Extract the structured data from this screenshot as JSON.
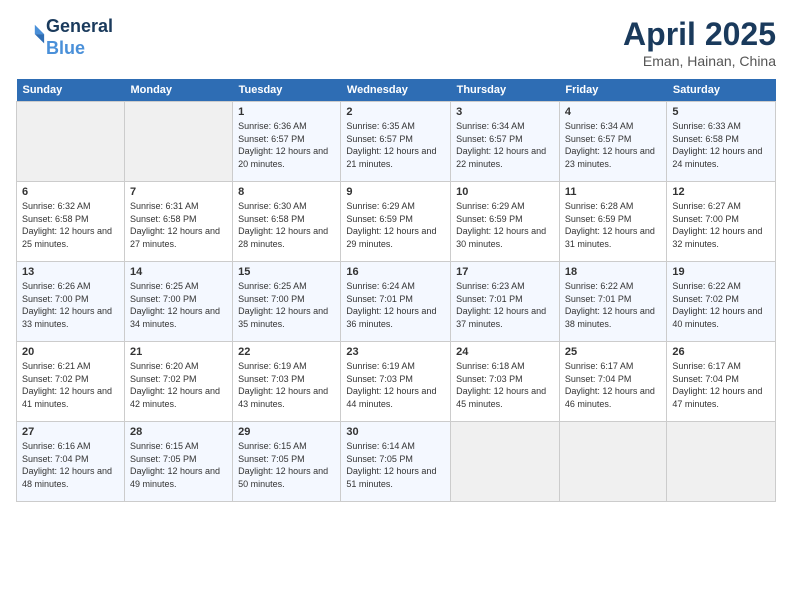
{
  "header": {
    "logo_line1": "General",
    "logo_line2": "Blue",
    "month_year": "April 2025",
    "location": "Eman, Hainan, China"
  },
  "weekdays": [
    "Sunday",
    "Monday",
    "Tuesday",
    "Wednesday",
    "Thursday",
    "Friday",
    "Saturday"
  ],
  "weeks": [
    [
      {
        "day": "",
        "info": ""
      },
      {
        "day": "",
        "info": ""
      },
      {
        "day": "1",
        "info": "Sunrise: 6:36 AM\nSunset: 6:57 PM\nDaylight: 12 hours and 20 minutes."
      },
      {
        "day": "2",
        "info": "Sunrise: 6:35 AM\nSunset: 6:57 PM\nDaylight: 12 hours and 21 minutes."
      },
      {
        "day": "3",
        "info": "Sunrise: 6:34 AM\nSunset: 6:57 PM\nDaylight: 12 hours and 22 minutes."
      },
      {
        "day": "4",
        "info": "Sunrise: 6:34 AM\nSunset: 6:57 PM\nDaylight: 12 hours and 23 minutes."
      },
      {
        "day": "5",
        "info": "Sunrise: 6:33 AM\nSunset: 6:58 PM\nDaylight: 12 hours and 24 minutes."
      }
    ],
    [
      {
        "day": "6",
        "info": "Sunrise: 6:32 AM\nSunset: 6:58 PM\nDaylight: 12 hours and 25 minutes."
      },
      {
        "day": "7",
        "info": "Sunrise: 6:31 AM\nSunset: 6:58 PM\nDaylight: 12 hours and 27 minutes."
      },
      {
        "day": "8",
        "info": "Sunrise: 6:30 AM\nSunset: 6:58 PM\nDaylight: 12 hours and 28 minutes."
      },
      {
        "day": "9",
        "info": "Sunrise: 6:29 AM\nSunset: 6:59 PM\nDaylight: 12 hours and 29 minutes."
      },
      {
        "day": "10",
        "info": "Sunrise: 6:29 AM\nSunset: 6:59 PM\nDaylight: 12 hours and 30 minutes."
      },
      {
        "day": "11",
        "info": "Sunrise: 6:28 AM\nSunset: 6:59 PM\nDaylight: 12 hours and 31 minutes."
      },
      {
        "day": "12",
        "info": "Sunrise: 6:27 AM\nSunset: 7:00 PM\nDaylight: 12 hours and 32 minutes."
      }
    ],
    [
      {
        "day": "13",
        "info": "Sunrise: 6:26 AM\nSunset: 7:00 PM\nDaylight: 12 hours and 33 minutes."
      },
      {
        "day": "14",
        "info": "Sunrise: 6:25 AM\nSunset: 7:00 PM\nDaylight: 12 hours and 34 minutes."
      },
      {
        "day": "15",
        "info": "Sunrise: 6:25 AM\nSunset: 7:00 PM\nDaylight: 12 hours and 35 minutes."
      },
      {
        "day": "16",
        "info": "Sunrise: 6:24 AM\nSunset: 7:01 PM\nDaylight: 12 hours and 36 minutes."
      },
      {
        "day": "17",
        "info": "Sunrise: 6:23 AM\nSunset: 7:01 PM\nDaylight: 12 hours and 37 minutes."
      },
      {
        "day": "18",
        "info": "Sunrise: 6:22 AM\nSunset: 7:01 PM\nDaylight: 12 hours and 38 minutes."
      },
      {
        "day": "19",
        "info": "Sunrise: 6:22 AM\nSunset: 7:02 PM\nDaylight: 12 hours and 40 minutes."
      }
    ],
    [
      {
        "day": "20",
        "info": "Sunrise: 6:21 AM\nSunset: 7:02 PM\nDaylight: 12 hours and 41 minutes."
      },
      {
        "day": "21",
        "info": "Sunrise: 6:20 AM\nSunset: 7:02 PM\nDaylight: 12 hours and 42 minutes."
      },
      {
        "day": "22",
        "info": "Sunrise: 6:19 AM\nSunset: 7:03 PM\nDaylight: 12 hours and 43 minutes."
      },
      {
        "day": "23",
        "info": "Sunrise: 6:19 AM\nSunset: 7:03 PM\nDaylight: 12 hours and 44 minutes."
      },
      {
        "day": "24",
        "info": "Sunrise: 6:18 AM\nSunset: 7:03 PM\nDaylight: 12 hours and 45 minutes."
      },
      {
        "day": "25",
        "info": "Sunrise: 6:17 AM\nSunset: 7:04 PM\nDaylight: 12 hours and 46 minutes."
      },
      {
        "day": "26",
        "info": "Sunrise: 6:17 AM\nSunset: 7:04 PM\nDaylight: 12 hours and 47 minutes."
      }
    ],
    [
      {
        "day": "27",
        "info": "Sunrise: 6:16 AM\nSunset: 7:04 PM\nDaylight: 12 hours and 48 minutes."
      },
      {
        "day": "28",
        "info": "Sunrise: 6:15 AM\nSunset: 7:05 PM\nDaylight: 12 hours and 49 minutes."
      },
      {
        "day": "29",
        "info": "Sunrise: 6:15 AM\nSunset: 7:05 PM\nDaylight: 12 hours and 50 minutes."
      },
      {
        "day": "30",
        "info": "Sunrise: 6:14 AM\nSunset: 7:05 PM\nDaylight: 12 hours and 51 minutes."
      },
      {
        "day": "",
        "info": ""
      },
      {
        "day": "",
        "info": ""
      },
      {
        "day": "",
        "info": ""
      }
    ]
  ]
}
